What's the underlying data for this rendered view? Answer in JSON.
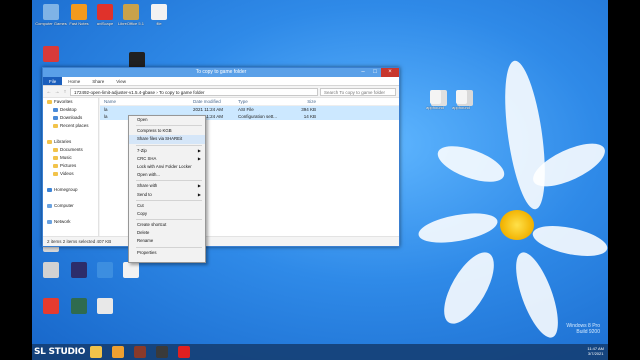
{
  "desktop_icons": [
    {
      "label": "Computer Games",
      "color": "#7fb3e6"
    },
    {
      "label": "Fast Notes",
      "color": "#f39a1d"
    },
    {
      "label": "aviScape",
      "color": "#e0322b"
    },
    {
      "label": "LibreOffice 5.1",
      "color": "#c9a24a"
    },
    {
      "label": "file",
      "color": "#f2f2f2"
    },
    {
      "label": "",
      "color": "#d83a3a"
    },
    {
      "label": "",
      "color": "#202020"
    },
    {
      "label": "",
      "color": "#3d84d6"
    },
    {
      "label": "",
      "color": "#e6e6e6"
    },
    {
      "label": "",
      "color": "#e8e8e8"
    },
    {
      "label": "",
      "color": "#1d1d1d"
    },
    {
      "label": "",
      "color": "#d8d8d8"
    },
    {
      "label": "",
      "color": "#e0e0e0"
    },
    {
      "label": "",
      "color": "#d9d9d9"
    },
    {
      "label": "",
      "color": "#d2d2d2"
    },
    {
      "label": "",
      "color": "#2d2d6a"
    },
    {
      "label": "",
      "color": "#3c8ee0"
    },
    {
      "label": "",
      "color": "#f2f2f2"
    },
    {
      "label": "",
      "color": "#e53b2f"
    },
    {
      "label": "",
      "color": "#2f6b4f"
    },
    {
      "label": "",
      "color": "#e8e8e8"
    },
    {
      "label": "apphound",
      "color": "#f4f4f4"
    },
    {
      "label": "apphound",
      "color": "#f4f4f4"
    }
  ],
  "explorer": {
    "title": "To copy to game folder",
    "tabs": [
      "File",
      "Home",
      "Share",
      "View"
    ],
    "address": "172492-open-limit-adjuster-v1.5.4-gbase  ›  To copy to game folder",
    "search_placeholder": "Search To copy to game folder",
    "nav_items": [
      {
        "label": "Favorites",
        "color": "#f2c34a"
      },
      {
        "label": "Desktop",
        "color": "#4a8ad8"
      },
      {
        "label": "Downloads",
        "color": "#4a8ad8"
      },
      {
        "label": "Recent places",
        "color": "#f2c34a"
      },
      {
        "label": "",
        "color": ""
      },
      {
        "label": "Libraries",
        "color": "#f2c34a"
      },
      {
        "label": "Documents",
        "color": "#f2c34a"
      },
      {
        "label": "Music",
        "color": "#f2c34a"
      },
      {
        "label": "Pictures",
        "color": "#f2c34a"
      },
      {
        "label": "Videos",
        "color": "#f2c34a"
      },
      {
        "label": "",
        "color": ""
      },
      {
        "label": "Homegroup",
        "color": "#3d84d6"
      },
      {
        "label": "",
        "color": ""
      },
      {
        "label": "Computer",
        "color": "#6aa2e0"
      },
      {
        "label": "",
        "color": ""
      },
      {
        "label": "Network",
        "color": "#6aa2e0"
      }
    ],
    "columns": {
      "name": "Name",
      "date": "Date modified",
      "type": "Type",
      "size": "Size"
    },
    "files": [
      {
        "name": "la",
        "date": "2021 11:24 AM",
        "type": "ASI File",
        "size": "394 KB"
      },
      {
        "name": "la",
        "date": "2021 11:24 AM",
        "type": "Configuration sett...",
        "size": "14 KB"
      }
    ],
    "status": "2 items   2 items selected  407 KB"
  },
  "context_menu": {
    "items": [
      {
        "label": "Open",
        "arrow": false,
        "hl": false
      },
      {
        "label": "Compress to KGB",
        "arrow": false,
        "hl": false
      },
      {
        "label": "Share files via SHAREit",
        "arrow": false,
        "hl": true
      },
      {
        "label": "7-Zip",
        "arrow": true,
        "hl": false
      },
      {
        "label": "CRC SHA",
        "arrow": true,
        "hl": false
      },
      {
        "label": "Lock with Anvi Folder Locker",
        "arrow": false,
        "hl": false
      },
      {
        "label": "Open with...",
        "arrow": false,
        "hl": false
      },
      {
        "label": "Share with",
        "arrow": true,
        "hl": false
      },
      {
        "label": "Send to",
        "arrow": true,
        "hl": false
      },
      {
        "label": "Cut",
        "arrow": false,
        "hl": false
      },
      {
        "label": "Copy",
        "arrow": false,
        "hl": false
      },
      {
        "label": "Create shortcut",
        "arrow": false,
        "hl": false
      },
      {
        "label": "Delete",
        "arrow": false,
        "hl": false
      },
      {
        "label": "Rename",
        "arrow": false,
        "hl": false
      },
      {
        "label": "Properties",
        "arrow": false,
        "hl": false
      }
    ]
  },
  "taskbar": {
    "watermark": "SL STUDIO",
    "icons": [
      "#f2c34a",
      "#f0a030",
      "#8a3a2a",
      "#3a3a3a",
      "#e02020"
    ],
    "clock_time": "11:47 AM",
    "clock_date": "3/7/2021"
  },
  "os_label": {
    "line1": "Windows 8 Pro",
    "line2": "Build 9200"
  }
}
